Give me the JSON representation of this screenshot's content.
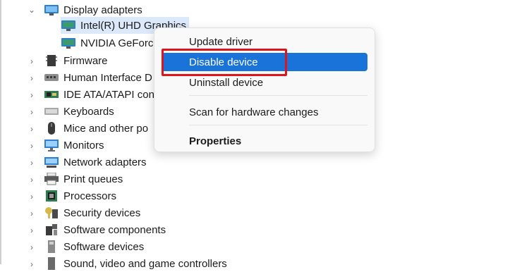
{
  "device_tree": {
    "display_adapters": {
      "label": "Display adapters",
      "children": [
        "Intel(R) UHD Graphics",
        "NVIDIA GeForce"
      ]
    },
    "categories": [
      "Firmware",
      "Human Interface D",
      "IDE ATA/ATAPI cont",
      "Keyboards",
      "Mice and other po",
      "Monitors",
      "Network adapters",
      "Print queues",
      "Processors",
      "Security devices",
      "Software components",
      "Software devices",
      "Sound, video and game controllers"
    ]
  },
  "context_menu": {
    "items": [
      "Update driver",
      "Disable device",
      "Uninstall device",
      "Scan for hardware changes",
      "Properties"
    ],
    "active_item": "Disable device"
  },
  "colors": {
    "selection_highlight": "#dbe9fb",
    "menu_active": "#1a73d8",
    "annotation_box": "#e0151c"
  }
}
